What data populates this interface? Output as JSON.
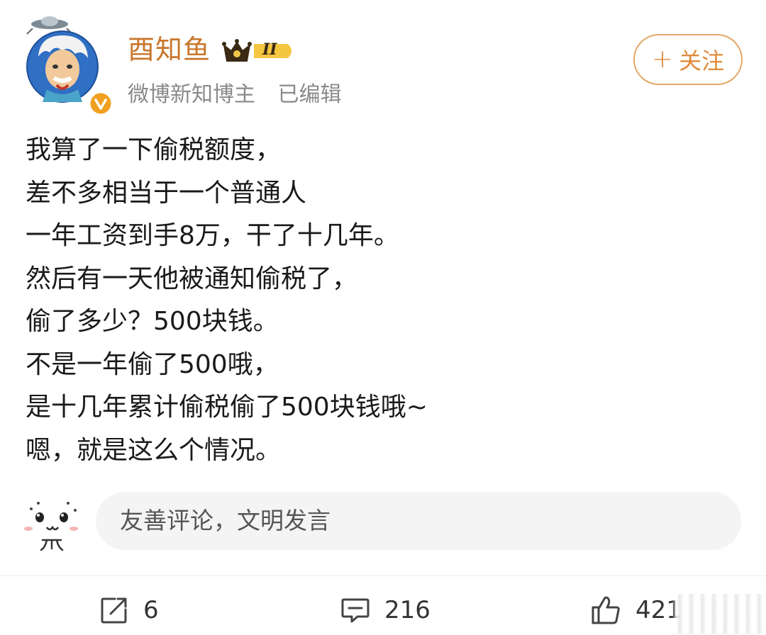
{
  "user": {
    "name": "酉知鱼",
    "level_badge": "II",
    "verified_title": "微博新知博主",
    "edited_label": "已编辑"
  },
  "follow_button": {
    "plus": "+",
    "label": "关注"
  },
  "post": {
    "lines": [
      "我算了一下偷税额度，",
      "差不多相当于一个普通人",
      "一年工资到手8万，干了十几年。",
      "然后有一天他被通知偷税了，",
      "偷了多少？500块钱。",
      "不是一年偷了500哦，",
      "是十几年累计偷税偷了500块钱哦~",
      "嗯，就是这么个情况。"
    ]
  },
  "comment_box": {
    "placeholder": "友善评论，文明发言"
  },
  "actions": {
    "repost_count": "6",
    "comment_count": "216",
    "like_count": "421"
  },
  "colors": {
    "accent": "#e08b3a",
    "username": "#c9762a",
    "verified_badge": "#f0a020",
    "avatar_bg": "#2f6fc4"
  },
  "icons": {
    "verified": "verified-v-icon",
    "crown": "crown-icon",
    "repost": "repost-icon",
    "comment": "comment-icon",
    "like": "like-icon",
    "emoji": "emoji-face-icon"
  }
}
